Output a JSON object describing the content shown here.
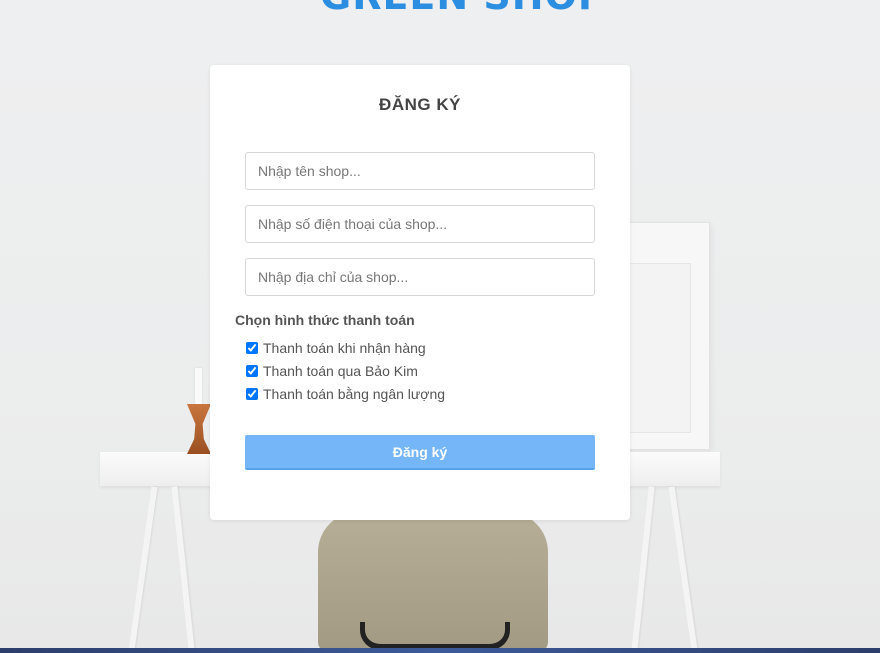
{
  "brand": {
    "title": "GREEN SHOP",
    "color": "#2b8ee0"
  },
  "form": {
    "title": "ĐĂNG KÝ",
    "fields": [
      {
        "placeholder": "Nhập tên shop..."
      },
      {
        "placeholder": "Nhập số điện thoại của shop..."
      },
      {
        "placeholder": "Nhập địa chỉ của shop..."
      }
    ],
    "payment": {
      "title": "Chọn hình thức thanh toán",
      "options": [
        {
          "label": "Thanh toán khi nhận hàng",
          "checked": true
        },
        {
          "label": "Thanh toán qua Bảo Kim",
          "checked": true
        },
        {
          "label": "Thanh toán bằng ngân lượng",
          "checked": true
        }
      ]
    },
    "submit_label": "Đăng ký",
    "submit_color": "#74b6f7"
  }
}
